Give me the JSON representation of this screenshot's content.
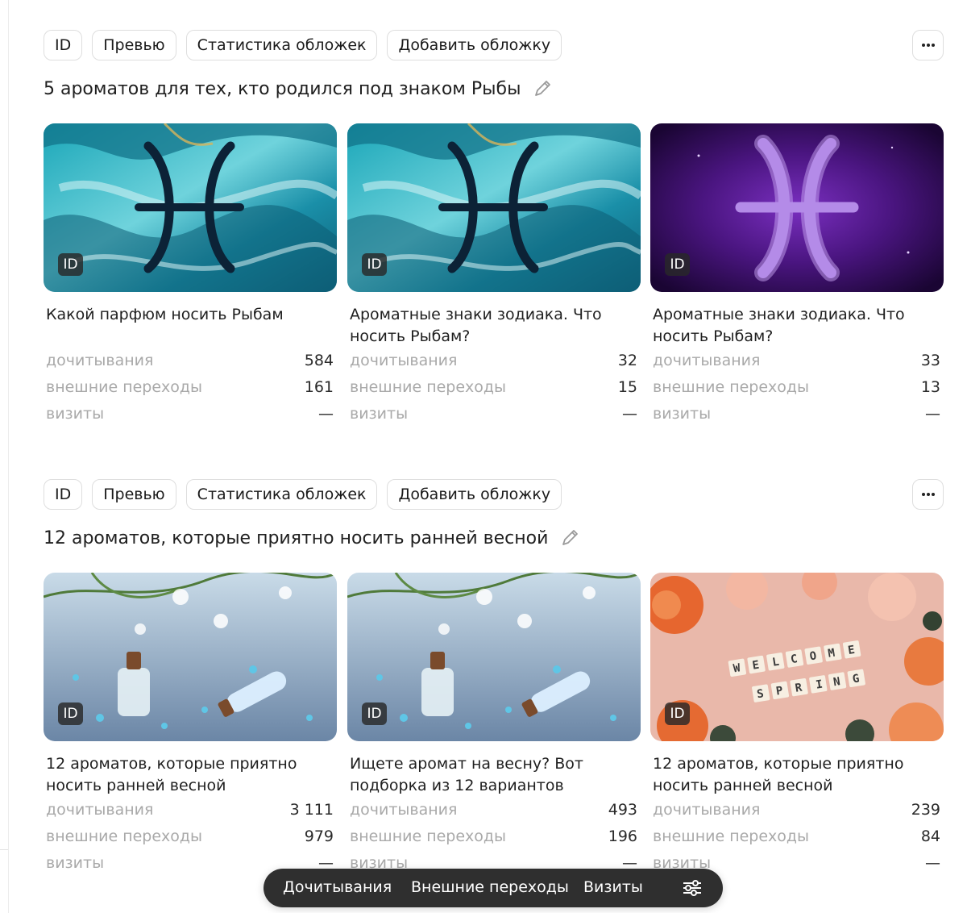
{
  "toolbar": {
    "id_label": "ID",
    "preview_label": "Превью",
    "cover_stats_label": "Статистика обложек",
    "add_cover_label": "Добавить обложку"
  },
  "badge_label": "ID",
  "stat_labels": {
    "reads": "дочитывания",
    "external": "внешние переходы",
    "visits": "визиты"
  },
  "sections": [
    {
      "title": "5 ароматов для тех, кто родился под знаком Рыбы",
      "cards": [
        {
          "title": "Какой парфюм носить Рыбам",
          "reads": "584",
          "external": "161",
          "visits": "—",
          "image": "pisces-symbol-on-turquoise-marble"
        },
        {
          "title": "Ароматные знаки зодиака. Что носить Рыбам?",
          "reads": "32",
          "external": "15",
          "visits": "—",
          "image": "pisces-symbol-on-turquoise-marble"
        },
        {
          "title": "Ароматные знаки зодиака. Что носить Рыбам?",
          "reads": "33",
          "external": "13",
          "visits": "—",
          "image": "glowing-purple-pisces-symbol"
        }
      ]
    },
    {
      "title": "12 ароматов, которые приятно носить ранней весной",
      "cards": [
        {
          "title": "12 ароматов, которые приятно носить ранней весной",
          "reads": "3 111",
          "external": "979",
          "visits": "—",
          "image": "perfume-bottles-with-flowers"
        },
        {
          "title": "Ищете аромат на весну? Вот подборка из 12 вариантов",
          "reads": "493",
          "external": "196",
          "visits": "—",
          "image": "perfume-bottles-with-flowers"
        },
        {
          "title": "12 ароматов, которые приятно носить ранней весной",
          "reads": "239",
          "external": "84",
          "visits": "—",
          "image": "welcome-spring-tiles-with-roses"
        }
      ]
    }
  ],
  "image_tiles": {
    "line1": [
      "W",
      "E",
      "L",
      "C",
      "O",
      "M",
      "E"
    ],
    "line2": [
      "S",
      "P",
      "R",
      "I",
      "N",
      "G"
    ]
  },
  "bottom_bar": {
    "reads": "Дочитывания",
    "external": "Внешние переходы",
    "visits": "Визиты"
  },
  "colors": {
    "accent_dark": "#2f2f2f",
    "muted_text": "#a9a9a9",
    "border": "#dedede"
  }
}
